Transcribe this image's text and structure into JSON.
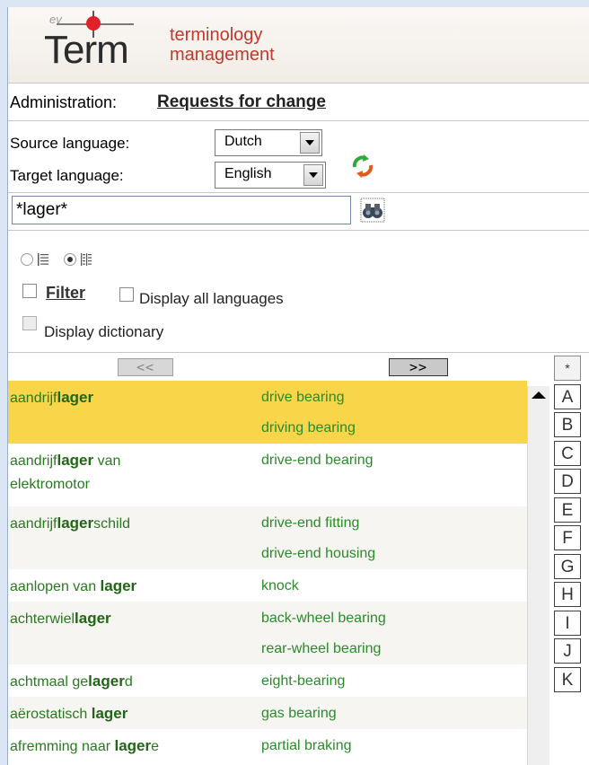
{
  "header": {
    "tagline_line1": "terminology",
    "tagline_line2": "management",
    "logo_text": "Term",
    "logo_prefix": "ev"
  },
  "admin": {
    "label": "Administration:",
    "link": "Requests for change"
  },
  "languages": {
    "source_label": "Source language:",
    "source_value": "Dutch",
    "target_label": "Target language:",
    "target_value": "English"
  },
  "search": {
    "value": "*lager*"
  },
  "options": {
    "filter_label": "Filter",
    "display_all_label": "Display all languages",
    "display_dictionary_label": "Display dictionary"
  },
  "nav": {
    "prev": "<<",
    "next": ">>"
  },
  "alphabet": [
    "*",
    "A",
    "B",
    "C",
    "D",
    "E",
    "F",
    "G",
    "H",
    "I",
    "J",
    "K"
  ],
  "results": [
    {
      "src": [
        [
          "aandrijf",
          ""
        ],
        [
          "lager",
          "b"
        ]
      ],
      "src2": null,
      "tgt": [
        "drive bearing",
        "driving bearing"
      ]
    },
    {
      "src": [
        [
          "aandrijf",
          ""
        ],
        [
          "lager",
          "b"
        ],
        [
          " van",
          ""
        ]
      ],
      "src2": "elektromotor",
      "tgt": [
        "drive-end bearing"
      ]
    },
    {
      "src": [
        [
          "aandrijf",
          ""
        ],
        [
          "lager",
          "b"
        ],
        [
          "schild",
          ""
        ]
      ],
      "src2": null,
      "tgt": [
        "drive-end fitting",
        "drive-end housing"
      ]
    },
    {
      "src": [
        [
          "aanlopen van ",
          ""
        ],
        [
          "lager",
          "b"
        ]
      ],
      "src2": null,
      "tgt": [
        "knock"
      ]
    },
    {
      "src": [
        [
          "achterwiel",
          ""
        ],
        [
          "lager",
          "b"
        ]
      ],
      "src2": null,
      "tgt": [
        "back-wheel bearing",
        "rear-wheel bearing"
      ]
    },
    {
      "src": [
        [
          "achtmaal ge",
          ""
        ],
        [
          "lager",
          "b"
        ],
        [
          "d",
          ""
        ]
      ],
      "src2": null,
      "tgt": [
        "eight-bearing"
      ]
    },
    {
      "src": [
        [
          "aërostatisch ",
          ""
        ],
        [
          "lager",
          "b"
        ]
      ],
      "src2": null,
      "tgt": [
        "gas bearing"
      ]
    },
    {
      "src": [
        [
          "afremming naar ",
          ""
        ],
        [
          "lager",
          "b"
        ],
        [
          "e",
          ""
        ]
      ],
      "src2": null,
      "tgt": [
        "partial braking"
      ]
    }
  ]
}
